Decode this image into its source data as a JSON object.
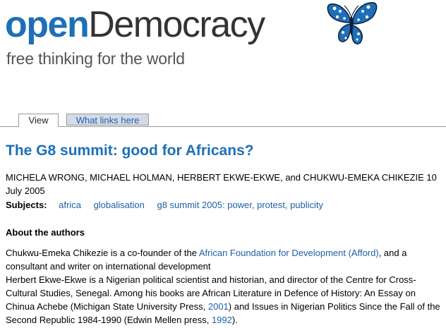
{
  "header": {
    "logo_open": "open",
    "logo_democracy": "Democracy",
    "tagline": "free thinking for the world"
  },
  "tabs": [
    {
      "label": "View",
      "active": true
    },
    {
      "label": "What links here",
      "active": false
    }
  ],
  "article": {
    "title": "The G8 summit: good for Africans?",
    "byline": "MICHELA WRONG, MICHAEL HOLMAN, HERBERT EKWE-EKWE, and CHUKWU-EMEKA CHIKEZIE 10 July 2005",
    "subjects_label": "Subjects:",
    "subjects": [
      "africa",
      "globalisation",
      "g8 summit 2005: power, protest, publicity"
    ],
    "about_heading": "About the authors",
    "bio1": {
      "before": "Chukwu-Emeka Chikezie is a co-founder of the ",
      "link": "African Foundation for Development (Afford)",
      "after": ", and a consultant and writer on international development"
    },
    "bio2": {
      "part1": "Herbert Ekwe-Ekwe is a Nigerian political scientist and historian, and director of the Centre for Cross-Cultural Studies, Senegal. Among his books are African Literature in Defence of History: An Essay on Chinua Achebe (Michigan State University Press, ",
      "link1": "2001",
      "part2": ") and Issues in Nigerian Politics Since the Fall of the Second Republic 1984-1990 (Edwin Mellen press, ",
      "link2": "1992",
      "part3": ")."
    }
  },
  "colors": {
    "brand_blue": "#1e6fb8",
    "link_blue": "#1e5fa8",
    "tab_inactive_bg": "#d4dbe7",
    "logo_grey": "#333333"
  },
  "icons": {
    "logo_mark": "butterfly-icon"
  }
}
